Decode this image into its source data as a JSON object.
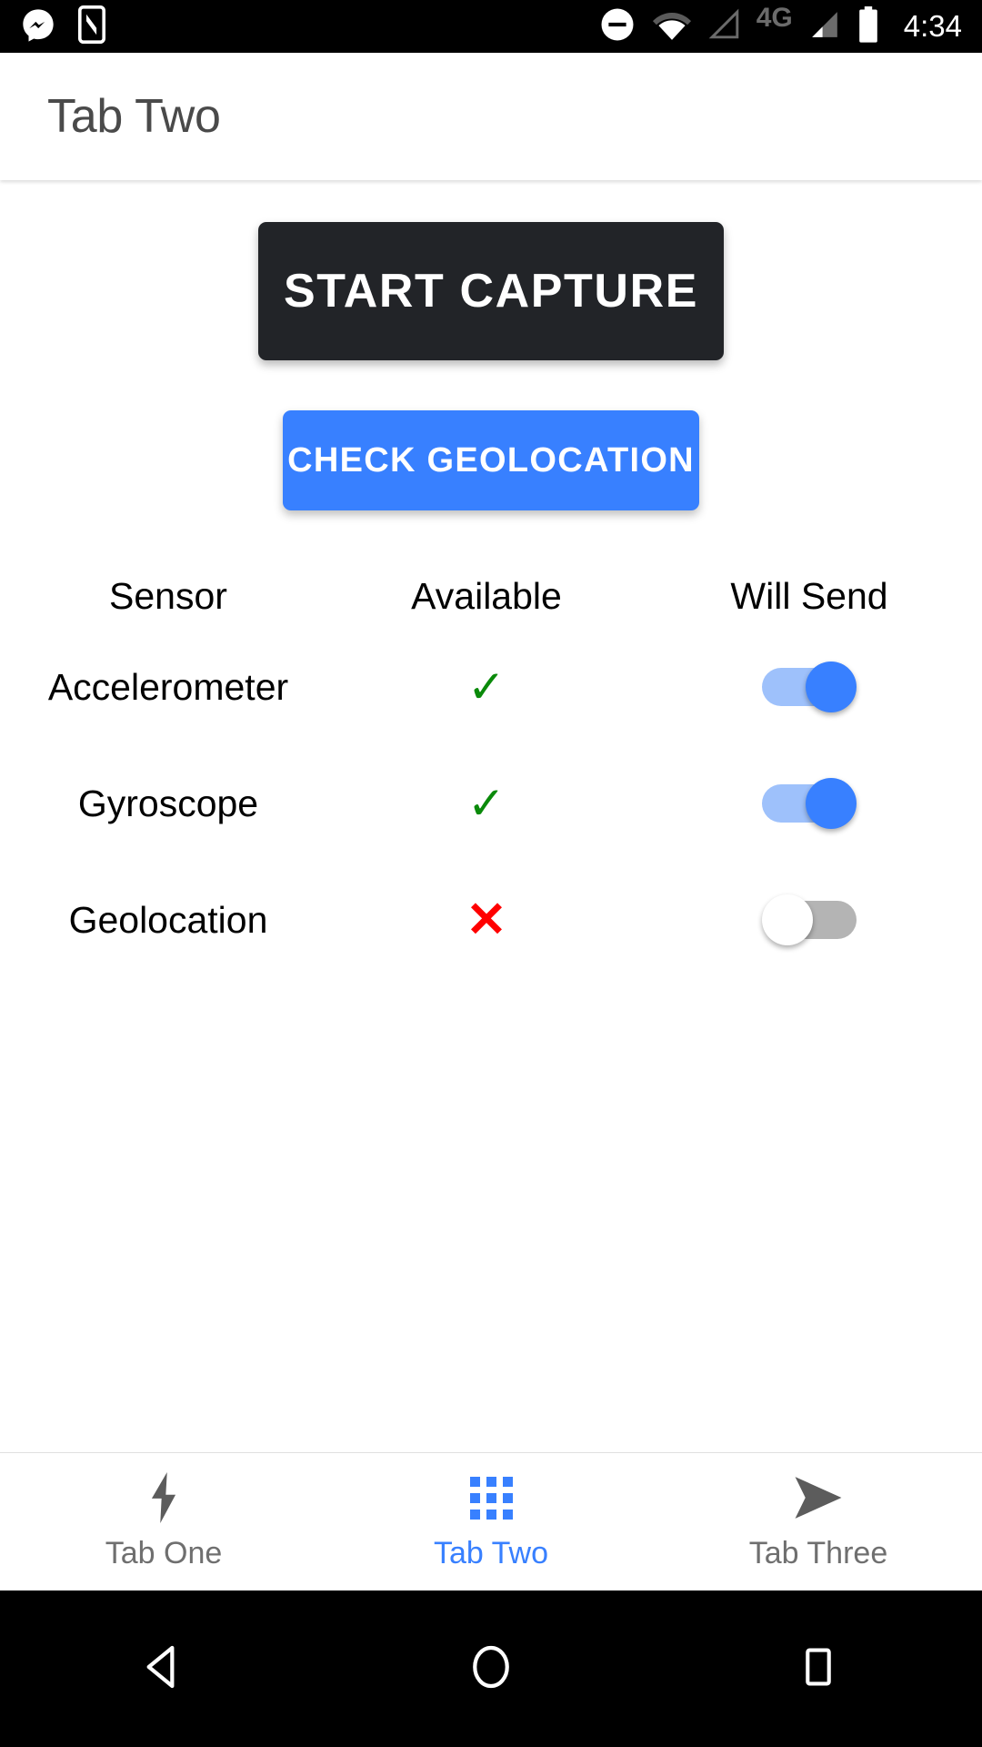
{
  "status_bar": {
    "time": "4:34",
    "network_type": "4G",
    "icons": [
      "messenger-icon",
      "phone-app-icon",
      "do-not-disturb-icon",
      "wifi-icon",
      "signal-empty-icon",
      "signal-bars-icon",
      "battery-icon"
    ]
  },
  "header": {
    "title": "Tab Two"
  },
  "main": {
    "start_capture_label": "START CAPTURE",
    "check_geolocation_label": "CHECK GEOLOCATION",
    "table": {
      "headers": [
        "Sensor",
        "Available",
        "Will Send"
      ],
      "rows": [
        {
          "sensor": "Accelerometer",
          "available": true,
          "available_glyph": "✓",
          "will_send": true
        },
        {
          "sensor": "Gyroscope",
          "available": true,
          "available_glyph": "✓",
          "will_send": true
        },
        {
          "sensor": "Geolocation",
          "available": false,
          "available_glyph": "✕",
          "will_send": false
        }
      ]
    }
  },
  "tabbar": {
    "tabs": [
      {
        "label": "Tab One",
        "icon": "flash-icon",
        "active": false
      },
      {
        "label": "Tab Two",
        "icon": "apps-grid-icon",
        "active": true
      },
      {
        "label": "Tab Three",
        "icon": "send-icon",
        "active": false
      }
    ]
  },
  "navbar": {
    "buttons": [
      "back-icon",
      "home-icon",
      "recents-icon"
    ]
  },
  "colors": {
    "primary_blue": "#3880ff",
    "dark_button": "#222428",
    "available_green": "#0a8a0a",
    "unavailable_red": "#ff0000",
    "toggle_on_track": "#9ec1fb",
    "toggle_off_track": "#b4b4b4",
    "header_text": "#4a4a4a",
    "tab_inactive": "#6f6f6f"
  }
}
